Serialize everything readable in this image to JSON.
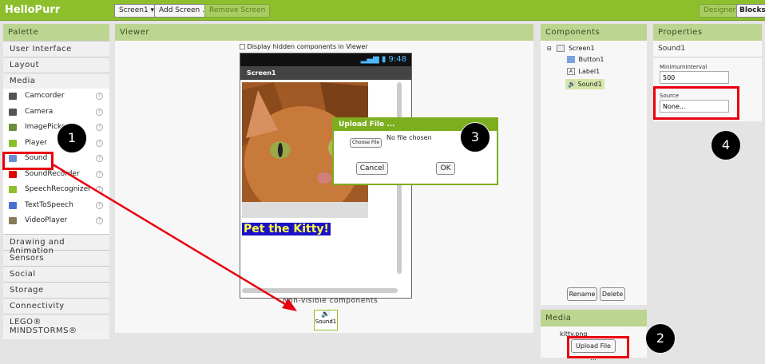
{
  "app_title": "HelloPurr",
  "toolbar": {
    "screen_dropdown": "Screen1 ▾",
    "add_screen": "Add Screen ...",
    "remove_screen": "Remove Screen",
    "designer": "Designer",
    "blocks": "Blocks"
  },
  "palette": {
    "header": "Palette",
    "categories_top": [
      "User Interface",
      "Layout",
      "Media"
    ],
    "media_items": [
      {
        "label": "Camcorder",
        "icon": "camcorder-icon",
        "color": "#555555"
      },
      {
        "label": "Camera",
        "icon": "camera-icon",
        "color": "#555555"
      },
      {
        "label": "ImagePicker",
        "icon": "image-picker-icon",
        "color": "#6a8f3a"
      },
      {
        "label": "Player",
        "icon": "player-icon",
        "color": "#8cbf2c"
      },
      {
        "label": "Sound",
        "icon": "sound-icon",
        "color": "#6a8fd0"
      },
      {
        "label": "SoundRecorder",
        "icon": "sound-recorder-icon",
        "color": "#e00000"
      },
      {
        "label": "SpeechRecognizer",
        "icon": "speech-recognizer-icon",
        "color": "#8cbf2c"
      },
      {
        "label": "TextToSpeech",
        "icon": "text-to-speech-icon",
        "color": "#4a6fd0"
      },
      {
        "label": "VideoPlayer",
        "icon": "video-player-icon",
        "color": "#8a7a5a"
      }
    ],
    "categories_bottom": [
      "Drawing and Animation",
      "Sensors",
      "Social",
      "Storage",
      "Connectivity",
      "LEGO® MINDSTORMS®"
    ]
  },
  "viewer": {
    "header": "Viewer",
    "hidden_checkbox_label": "Display hidden components in Viewer",
    "status_time": "9:48",
    "screen_title": "Screen1",
    "label_text": "Pet the Kitty!",
    "non_visible_label": "Non-visible components",
    "non_visible_item": "Sound1"
  },
  "dialog": {
    "title": "Upload File ...",
    "choose_file": "Choose File",
    "no_file": "No file chosen",
    "cancel": "Cancel",
    "ok": "OK"
  },
  "components": {
    "header": "Components",
    "tree": [
      "Screen1",
      "Button1",
      "Label1",
      "Sound1"
    ],
    "rename": "Rename",
    "delete": "Delete"
  },
  "media": {
    "header": "Media",
    "file": "kitty.png",
    "upload": "Upload File ..."
  },
  "properties": {
    "header": "Properties",
    "component": "Sound1",
    "min_interval_label": "MinimumInterval",
    "min_interval_value": "500",
    "source_label": "Source",
    "source_value": "None..."
  },
  "callouts": [
    "1",
    "2",
    "3",
    "4"
  ]
}
